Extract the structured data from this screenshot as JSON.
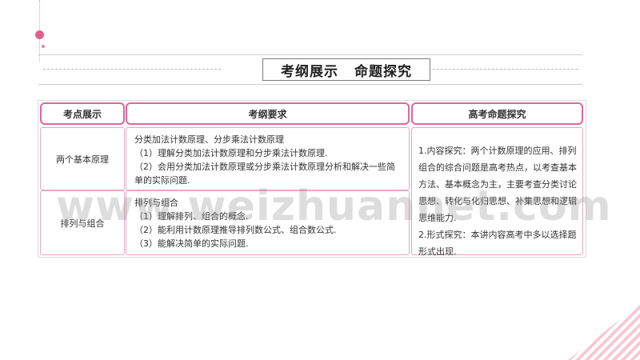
{
  "title": {
    "part1": "考纲展示",
    "part2": "命题探究"
  },
  "table": {
    "headers": {
      "col1": "考点展示",
      "col2": "考纲要求",
      "col3": "高考命题探究"
    },
    "rows": [
      {
        "topic": "两个基本原理",
        "requirements": [
          "分类加法计数原理、分步乘法计数原理",
          "（1）理解分类加法计数原理和分步乘法计数原理.",
          "（2）会用分类加法计数原理或分步乘法计数原理分析和解决一些简单的实际问题."
        ]
      },
      {
        "topic": "排列与组合",
        "requirements": [
          "排列与组合",
          "（1）理解排列、组合的概念.",
          "（2）能利用计数原理推导排列数公式、组合数公式.",
          "（3）能解决简单的实际问题."
        ]
      }
    ],
    "exam_exploration": [
      "1.内容探究：两个计数原理的应用、排列组合的综合问题是高考热点，以考查基本方法、基本概念为主，主要考查分类讨论思想、转化与化归思想、补集思想和逻辑思维能力.",
      "2.形式探究：本讲内容高考中多以选择题形式出现."
    ]
  },
  "watermark": "www.weizhuannet.com",
  "colors": {
    "accent": "#e0669a",
    "border": "#e6a8c4"
  }
}
